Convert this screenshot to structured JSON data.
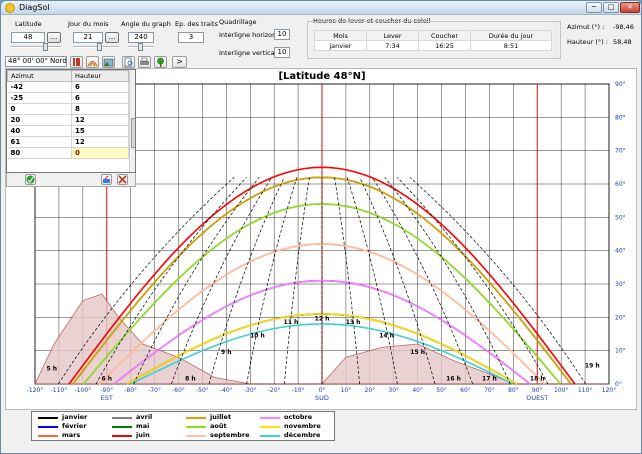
{
  "window": {
    "title": "DiagSol",
    "min": "─",
    "max": "□",
    "close": "✕"
  },
  "controls": {
    "latitude": {
      "label": "Latitude",
      "value": "48",
      "btn": "...",
      "dms": "48° 00' 00\" Nord"
    },
    "day": {
      "label": "Jour du mois",
      "value": "21",
      "btn": "..."
    },
    "angle": {
      "label": "Angle du graph",
      "value": "240"
    },
    "ep": {
      "label": "Ep. des traits",
      "value": "3"
    },
    "quadrillage": {
      "label": "Quadrillage",
      "horizontal_label": "Interligne horizontal",
      "horizontal_value": "10",
      "vertical_label": "Interligne vertical",
      "vertical_value": "10"
    },
    "next_btn": ">"
  },
  "sun_times": {
    "title": "Heures de lever et coucher du soleil",
    "headers": [
      "Mois",
      "Lever",
      "Coucher",
      "Durée du jour"
    ],
    "row": [
      "janvier",
      "7:34",
      "16:25",
      "8:51"
    ]
  },
  "readouts": {
    "azimut_label": "Azimut (°) :",
    "azimut_value": "-98,46",
    "hauteur_label": "Hauteur (°) :",
    "hauteur_value": "58,48"
  },
  "azimut_table": {
    "headers": [
      "Azimut",
      "Hauteur"
    ],
    "rows": [
      [
        "-42",
        "6"
      ],
      [
        "-25",
        "6"
      ],
      [
        "0",
        "8"
      ],
      [
        "20",
        "12"
      ],
      [
        "40",
        "15"
      ],
      [
        "61",
        "12"
      ],
      [
        "80",
        "0"
      ]
    ]
  },
  "chart_data": {
    "type": "line",
    "title": "[Latitude 48°N]",
    "x_ticks": [
      "-120°",
      "-110°",
      "-100°",
      "-90°",
      "-80°",
      "-70°",
      "-60°",
      "-50°",
      "-40°",
      "-30°",
      "-20°",
      "-10°",
      "0°",
      "10°",
      "20°",
      "30°",
      "40°",
      "50°",
      "60°",
      "70°",
      "80°",
      "90°",
      "100°",
      "110°",
      "120°"
    ],
    "y_ticks": [
      "0°",
      "10°",
      "20°",
      "30°",
      "40°",
      "50°",
      "60°",
      "70°",
      "80°",
      "90°"
    ],
    "xlim": [
      -120,
      120
    ],
    "ylim": [
      0,
      90
    ],
    "direction_labels": {
      "est": "EST",
      "sud": "SUD",
      "ouest": "OUEST"
    },
    "hour_labels": [
      "5 h",
      "6 h",
      "8 h",
      "9 h",
      "10 h",
      "11 h",
      "12 h",
      "13 h",
      "14 h",
      "15 h",
      "16 h",
      "17 h",
      "18 h",
      "19 h"
    ],
    "series": [
      {
        "name": "janvier",
        "color": "#000000",
        "noon_altitude": 21
      },
      {
        "name": "février",
        "color": "#0000ff",
        "noon_altitude": 31
      },
      {
        "name": "mars",
        "color": "#ff6040",
        "noon_altitude": 42
      },
      {
        "name": "avril",
        "color": "#808080",
        "noon_altitude": 54
      },
      {
        "name": "mai",
        "color": "#008000",
        "noon_altitude": 62
      },
      {
        "name": "juin",
        "color": "#ff0000",
        "noon_altitude": 65
      },
      {
        "name": "juillet",
        "color": "#e0a000",
        "noon_altitude": 62
      },
      {
        "name": "août",
        "color": "#90e020",
        "noon_altitude": 54
      },
      {
        "name": "septembre",
        "color": "#ffc0a0",
        "noon_altitude": 42
      },
      {
        "name": "octobre",
        "color": "#ff80ff",
        "noon_altitude": 31
      },
      {
        "name": "novembre",
        "color": "#ffe000",
        "noon_altitude": 21
      },
      {
        "name": "décembre",
        "color": "#40d0d0",
        "noon_altitude": 18
      }
    ]
  },
  "legend": [
    "janvier",
    "février",
    "mars",
    "avril",
    "mai",
    "juin",
    "juillet",
    "août",
    "septembre",
    "octobre",
    "novembre",
    "décembre"
  ]
}
